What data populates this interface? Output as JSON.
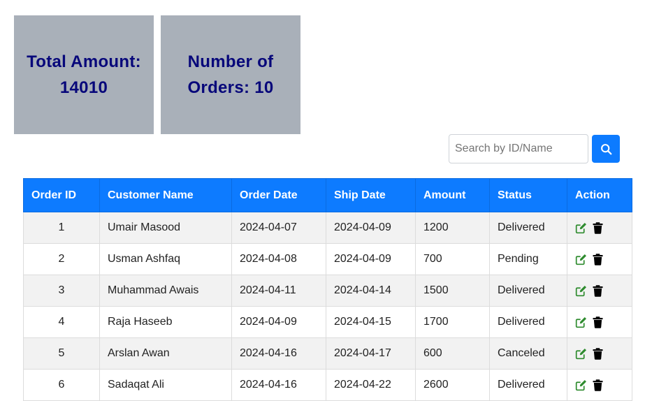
{
  "summary": {
    "total_label": "Total Amount:",
    "total_value": "14010",
    "orders_label": "Number of Orders:",
    "orders_value": "10"
  },
  "search": {
    "placeholder": "Search by ID/Name",
    "value": ""
  },
  "table": {
    "headers": [
      "Order ID",
      "Customer Name",
      "Order Date",
      "Ship Date",
      "Amount",
      "Status",
      "Action"
    ],
    "rows": [
      {
        "id": "1",
        "name": "Umair Masood",
        "order_date": "2024-04-07",
        "ship_date": "2024-04-09",
        "amount": "1200",
        "status": "Delivered"
      },
      {
        "id": "2",
        "name": "Usman Ashfaq",
        "order_date": "2024-04-08",
        "ship_date": "2024-04-09",
        "amount": "700",
        "status": "Pending"
      },
      {
        "id": "3",
        "name": "Muhammad Awais",
        "order_date": "2024-04-11",
        "ship_date": "2024-04-14",
        "amount": "1500",
        "status": "Delivered"
      },
      {
        "id": "4",
        "name": "Raja Haseeb",
        "order_date": "2024-04-09",
        "ship_date": "2024-04-15",
        "amount": "1700",
        "status": "Delivered"
      },
      {
        "id": "5",
        "name": "Arslan Awan",
        "order_date": "2024-04-16",
        "ship_date": "2024-04-17",
        "amount": "600",
        "status": "Canceled"
      },
      {
        "id": "6",
        "name": "Sadaqat Ali",
        "order_date": "2024-04-16",
        "ship_date": "2024-04-22",
        "amount": "2600",
        "status": "Delivered"
      }
    ]
  },
  "icons": {
    "search": "search-icon",
    "edit": "edit-icon",
    "delete": "trash-icon"
  },
  "colors": {
    "accent": "#0d7bff",
    "card_background": "#a9b0b9",
    "card_text": "#07077a",
    "edit_icon": "#2e8b2e",
    "delete_icon": "#000000"
  }
}
